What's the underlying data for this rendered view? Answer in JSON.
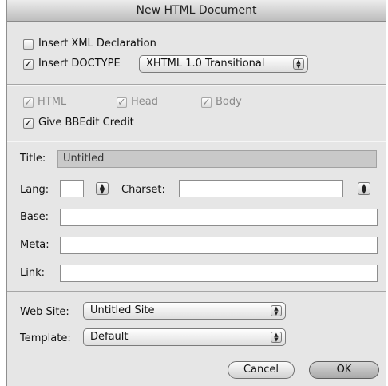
{
  "window": {
    "title": "New HTML Document"
  },
  "options": {
    "xml_declaration": {
      "label": "Insert XML Declaration",
      "checked": false
    },
    "doctype": {
      "label": "Insert DOCTYPE",
      "checked": true,
      "selected": "XHTML 1.0 Transitional"
    },
    "html": {
      "label": "HTML",
      "checked": true,
      "enabled": false
    },
    "head": {
      "label": "Head",
      "checked": true,
      "enabled": false
    },
    "body": {
      "label": "Body",
      "checked": true,
      "enabled": false
    },
    "credit": {
      "label": "Give BBEdit Credit",
      "checked": true
    },
    "check_glyph": "✓"
  },
  "fields": {
    "title": {
      "label": "Title:",
      "value": "Untitled"
    },
    "lang": {
      "label": "Lang:",
      "value": ""
    },
    "charset": {
      "label": "Charset:",
      "value": ""
    },
    "base": {
      "label": "Base:",
      "value": ""
    },
    "meta": {
      "label": "Meta:",
      "value": ""
    },
    "link": {
      "label": "Link:",
      "value": ""
    }
  },
  "site": {
    "web_site": {
      "label": "Web Site:",
      "selected": "Untitled Site"
    },
    "template": {
      "label": "Template:",
      "selected": "Default"
    }
  },
  "buttons": {
    "cancel": "Cancel",
    "ok": "OK"
  },
  "icons": {
    "popup_arrows": "up-down-arrows-icon",
    "stepper": "stepper-arrows-icon"
  }
}
